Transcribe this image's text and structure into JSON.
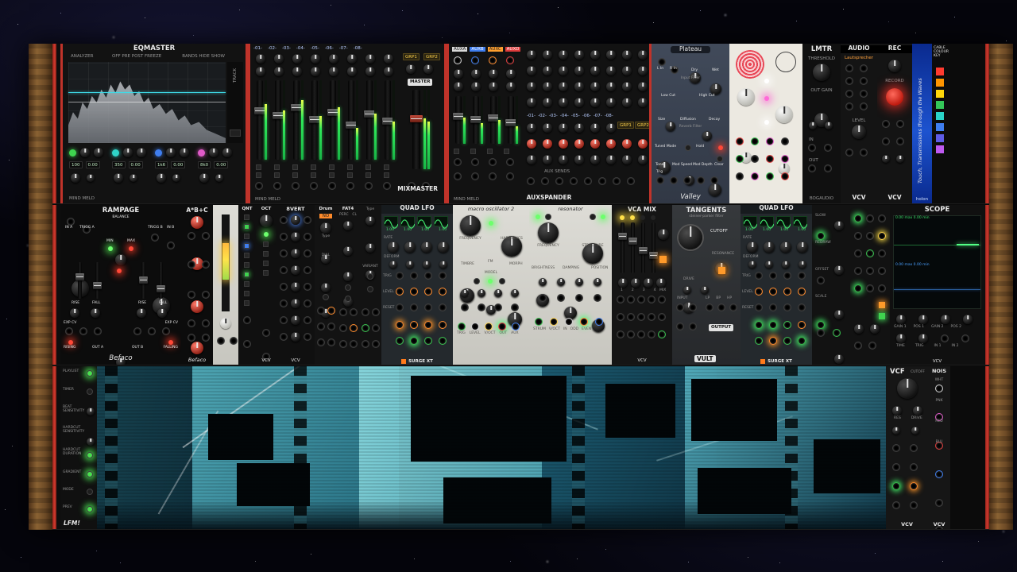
{
  "colors": {
    "rail_red": "#d03a2e",
    "wood": "#7a5530",
    "led_green": "#62ff62",
    "led_red": "#ff4040",
    "led_yellow": "#ffe04a",
    "led_pink": "#ff5ad0",
    "port_orange": "#ff8a2a",
    "surge_orange": "#ff7a1a",
    "display_green": "#3fe06a",
    "scope_blue": "#4aa0ff",
    "visual_teal": "#6fd0d8"
  },
  "row1": {
    "eqmaster": {
      "title": "EQMASTER",
      "analyzer": "ANALYZER",
      "modes": "OFF PRE POST FREEZE",
      "bands": "BANDS HIDE SHOW",
      "track": "TRACK",
      "band_freqs": [
        "100",
        "350",
        "1k6",
        "8k0"
      ],
      "band_gains": [
        "0.00",
        "0.00",
        "0.00",
        "0.00"
      ],
      "brand": "MIND MELD"
    },
    "mixmaster": {
      "channels": [
        "-01-",
        "-02-",
        "-03-",
        "-04-",
        "-05-",
        "-06-",
        "-07-",
        "-08-"
      ],
      "grp1": "GRP1",
      "grp2": "GRP2",
      "master": "MASTER",
      "title": "MIXMASTER",
      "brand": "MIND MELD"
    },
    "auxspander": {
      "auxes": [
        "AUXA",
        "AUXB",
        "AUXC",
        "AUXD"
      ],
      "channels": [
        "-01-",
        "-02-",
        "-03-",
        "-04-",
        "-05-",
        "-06-",
        "-07-",
        "-08-"
      ],
      "grp1": "GRP1",
      "grp2": "GRP2",
      "sends": "AUX SENDS",
      "title": "AUXSPANDER",
      "brand": "MIND MELD"
    },
    "plateau": {
      "title": "Plateau",
      "lin": "L In",
      "rin": "R In",
      "dry": "Dry",
      "wet": "Wet",
      "input_filter": "Input Filter",
      "low_cut": "Low Cut",
      "high_cut": "High Cut",
      "size": "Size",
      "diffusion": "Diffusion",
      "decay": "Decay",
      "reverb_filter": "Reverb Filter",
      "tuned": "Tuned Mode",
      "trig": "Trig",
      "tone": "Tone",
      "mod_speed": "Mod Speed",
      "mod_depth": "Mod Depth",
      "clear": "Clear",
      "hold": "Hold",
      "brand": "Valley"
    },
    "lmtr": {
      "title": "LMTR",
      "threshold": "THRESHOLD",
      "out_gain": "OUT GAIN",
      "in": "IN",
      "out": "OUT",
      "brand": "BOGAUDIO"
    },
    "audio": {
      "title": "AUDIO",
      "device": "Lautsprecher",
      "level": "LEVEL",
      "brand": "VCV"
    },
    "rec": {
      "title": "REC",
      "record": "RECORD",
      "brand": "VCV"
    },
    "cablekey": {
      "heading": "CABLE COLOUR KEY",
      "quote": "Touch, Transmissions through the Waves",
      "brand": "holon"
    }
  },
  "row2": {
    "rampage": {
      "title": "RAMPAGE",
      "in_a": "IN A",
      "trigg_a": "TRIGG A",
      "in_b": "IN B",
      "trigg_b": "TRIGG B",
      "balance": "BALANCE",
      "min": "MIN",
      "max": "MAX",
      "rise": "RISE",
      "fall": "FALL",
      "exp_cv": "EXP CV",
      "rising": "RISING",
      "falling": "FALLING",
      "out_a": "OUT A",
      "out_b": "OUT B",
      "brand": "Befaco"
    },
    "abc": {
      "title": "A*B+C",
      "brand": "Befaco"
    },
    "qnt": {
      "title": "QNT"
    },
    "oct": {
      "title": "OCT",
      "brand": "VCV"
    },
    "vert8": {
      "title": "8VERT",
      "brand": "VCV"
    },
    "drum": {
      "title": "Drum",
      "chip": "NO",
      "l1": "Type",
      "l2": "DIAL"
    },
    "fat4": {
      "title": "FAT4",
      "l1": "PERC",
      "l2": "CL"
    },
    "typec": {
      "l1": "Type",
      "l2": "VARIANT"
    },
    "quadlfo": {
      "title": "QUAD LFO",
      "rate": "RATE",
      "deform": "DEFORM",
      "trig": "TRIG",
      "level": "LEVEL",
      "reset": "RESET",
      "values": [
        "1.00",
        "1.00",
        "1.00",
        "1.00"
      ],
      "brand": "SURGE XT"
    },
    "macro": {
      "title": "macro oscillator 2",
      "frequency": "FREQUENCY",
      "harmonics": "HARMONICS",
      "timbre": "TIMBRE",
      "fm": "FM",
      "morph": "MORPH",
      "model": "MODEL",
      "ports": [
        "TRIG",
        "LEVEL",
        "V/OCT",
        "OUT",
        "AUX"
      ]
    },
    "resonator": {
      "title": "resonator",
      "frequency": "FREQUENCY",
      "structure": "STRUCTURE",
      "brightness": "BRIGHTNESS",
      "damping": "DAMPING",
      "position": "POSITION",
      "ports": [
        "STRUM",
        "V/OCT",
        "IN",
        "ODD",
        "EVEN"
      ]
    },
    "vcamix": {
      "title": "VCA MIX",
      "mix": "MIX",
      "chans": [
        "1",
        "2",
        "3",
        "4"
      ],
      "brand": "VCV"
    },
    "tangents": {
      "title": "TANGENTS",
      "subtitle": "steiner-parker filter",
      "cutoff": "CUTOFF",
      "resonance": "RESONANCE",
      "drive": "DRIVE",
      "input": "INPUT",
      "output": "OUTPUT",
      "outs": [
        "LP",
        "BP",
        "HP"
      ],
      "brand": "VULT"
    },
    "utila": {
      "labels": [
        "SLOW",
        "REDRAW",
        "OFFSET",
        "SCALE"
      ]
    },
    "scope": {
      "title": "SCOPE",
      "ch1": "0.00 max  0.00 min",
      "ch2": "0.00 max  0.00 min",
      "knobs": [
        "GAIN 1",
        "POS 1",
        "GAIN 2",
        "POS 2"
      ],
      "knobs2": [
        "TIME",
        "TRIG"
      ],
      "ports": [
        "IN 1",
        "IN 2"
      ],
      "brand": "VCV"
    }
  },
  "row3": {
    "lfm": {
      "rows": [
        "PLAYLIST",
        "TIMER",
        "BEAT SENSITIVITY",
        "HARDCUT SENSITIVITY",
        "HARDCUT DURATION",
        "GRADIENT",
        "MODE",
        "PREV"
      ],
      "brand": "LFM!"
    },
    "vcf": {
      "title": "VCF",
      "cutoff": "CUTOFF",
      "res": "RES",
      "drive": "DRIVE",
      "brand": "VCV"
    },
    "nois": {
      "title": "NOIS",
      "ports": [
        "WHT",
        "PNK",
        "RED",
        "BLU"
      ],
      "brand": "VCV"
    }
  }
}
